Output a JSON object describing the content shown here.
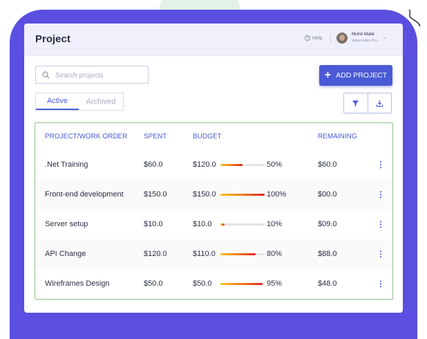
{
  "header": {
    "title": "Project",
    "help_label": "Help",
    "user_name": "Mohit Malik",
    "user_org": "Valuecoders Pvt..."
  },
  "toolbar": {
    "search_placeholder": "Search projects",
    "add_label": "ADD PROJECT"
  },
  "tabs": [
    {
      "label": "Active",
      "active": true
    },
    {
      "label": "Archived",
      "active": false
    }
  ],
  "table": {
    "columns": [
      "PROJECT/WORK ORDER",
      "SPENT",
      "BUDGET",
      "REMAINING"
    ],
    "rows": [
      {
        "name": ".Net Training",
        "spent": "$60.0",
        "budget": "$120.0",
        "pct_label": "50%",
        "pct": 50,
        "remaining": "$60.0"
      },
      {
        "name": "Front-end development",
        "spent": "$150.0",
        "budget": "$150.0",
        "pct_label": "100%",
        "pct": 100,
        "remaining": "$00.0"
      },
      {
        "name": "Server setup",
        "spent": "$10.0",
        "budget": "$10.0",
        "pct_label": "10%",
        "pct": 10,
        "remaining": "$09.0"
      },
      {
        "name": "API Change",
        "spent": "$120.0",
        "budget": "$110.0",
        "pct_label": "80%",
        "pct": 80,
        "remaining": "$88.0"
      },
      {
        "name": "Wireframes Design",
        "spent": "$50.0",
        "budget": "$50.0",
        "pct_label": "95%",
        "pct": 95,
        "remaining": "$48.0"
      }
    ]
  },
  "icons": {
    "search": "search-icon",
    "add": "plus-icon",
    "filter": "filter-icon",
    "download": "download-icon",
    "row_menu": "more-vertical-icon",
    "help": "help-circle-icon"
  },
  "colors": {
    "accent": "#4a5ad6",
    "backdrop": "#5a4fe0",
    "table_border": "#8bc28b",
    "bar_start": "#f7c61a",
    "bar_end": "#e5231b"
  }
}
